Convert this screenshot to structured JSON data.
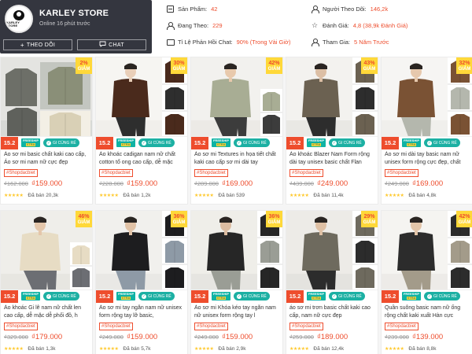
{
  "shop": {
    "name": "KARLEY STORE",
    "online": "Online 16 phút trước",
    "logo_text": "KARLEY STORE",
    "follow_label": "THEO DÕI",
    "chat_label": "CHAT"
  },
  "stats": {
    "products_label": "Sản Phẩm:",
    "products_value": "42",
    "following_label": "Đang Theo:",
    "following_value": "229",
    "response_label": "Tỉ Lệ Phản Hồi Chat:",
    "response_value": "90% (Trong Vài Giờ)",
    "followers_label": "Người Theo Dõi:",
    "followers_value": "146,2k",
    "rating_label": "Đánh Giá:",
    "rating_value": "4,8 (38,9k Đánh Giá)",
    "joined_label": "Tham Gia:",
    "joined_value": "5 Năm Trước"
  },
  "promo": {
    "date": "15.2",
    "freeship_1": "FREESHIP",
    "freeship_2": "XTRA",
    "cheap": "GI CÙNG RẺ"
  },
  "discount_word": "GIẢM",
  "tag": "#Shopdacbiet",
  "sold_prefix": "Đã bán",
  "products": [
    {
      "title": "Áo sơ mi basic chất kaki cao cấp, Áo sơ mi nam nữ cực đẹp",
      "old_price": "₫162.000",
      "new_price": "₫159.000",
      "sold": "20,3k",
      "discount": "2%"
    },
    {
      "title": "Áo khoác cadigan nam nữ chất cotton tổ ong cao cấp, dễ mặc",
      "old_price": "₫228.000",
      "new_price": "₫159.000",
      "sold": "1,2k",
      "discount": "30%"
    },
    {
      "title": "Áo sơ mi Textures in họa tiết chất kaki cao cấp sơ mi dài tay",
      "old_price": "₫289.000",
      "new_price": "₫169.000",
      "sold": "539",
      "discount": "42%"
    },
    {
      "title": "Áo khoác Blazer Nam Form rộng dài tay unisex basic chất Flan",
      "old_price": "₫439.000",
      "new_price": "₫249.000",
      "sold": "11,4k",
      "discount": "43%"
    },
    {
      "title": "Áo sơ mi dài tay basic nam nữ unisex form rộng cực đẹp, chất",
      "old_price": "₫249.000",
      "new_price": "₫169.000",
      "sold": "4,8k",
      "discount": "32%"
    },
    {
      "title": "Áo khoác Gi lê nam nữ chất len cao cấp, dễ mặc dễ phối đồ, h",
      "old_price": "₫329.000",
      "new_price": "₫179.000",
      "sold": "1,3k",
      "discount": "46%"
    },
    {
      "title": "Áo sơ mi tay ngắn nam nữ unisex form rộng tay lỡ basic,",
      "old_price": "₫249.000",
      "new_price": "₫159.000",
      "sold": "5,7k",
      "discount": "36%"
    },
    {
      "title": "Áo sơ mi Khóa kéo tay ngắn nam nữ unisex form rộng tay l",
      "old_price": "₫249.000",
      "new_price": "₫159.000",
      "sold": "2,9k",
      "discount": "36%"
    },
    {
      "title": "áo sơ mi trơn basic chất kaki cao cấp, nam nữ cực đẹp",
      "old_price": "₫259.000",
      "new_price": "₫189.000",
      "sold": "12,4k",
      "discount": "29%"
    },
    {
      "title": "Quần suông basic nam nữ ống rộng chất kaki xuất Hàn cực",
      "old_price": "₫239.000",
      "new_price": "₫139.000",
      "sold": "8,8k",
      "discount": "42%"
    }
  ]
}
